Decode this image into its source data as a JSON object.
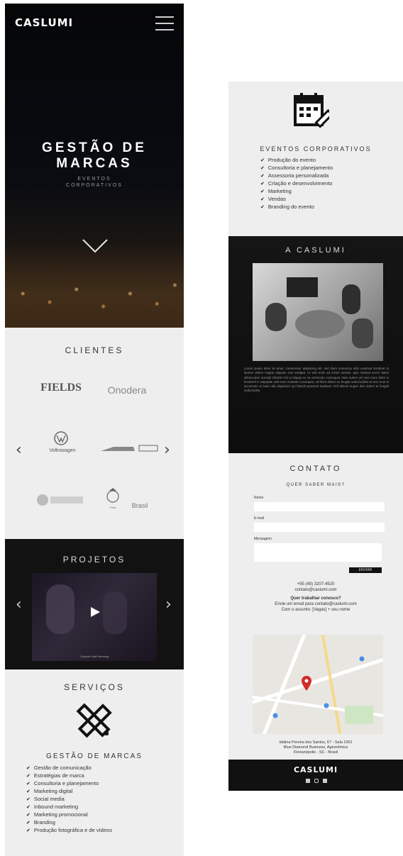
{
  "brand": {
    "logo": "CASLUMI"
  },
  "hero": {
    "title_line1": "GESTÃO DE",
    "title_line2": "MARCAS",
    "subtitle_line1": "EVENTOS",
    "subtitle_line2": "CORPORATIVOS"
  },
  "clientes": {
    "title": "CLIENTES",
    "logos": [
      "FIELDS",
      "Onodera",
      "Volkswagen",
      "",
      "",
      "",
      "Real",
      "Brasil"
    ]
  },
  "projetos": {
    "title": "PROJETOS",
    "caption": "Caslumi Kraft Wenning"
  },
  "servicos": {
    "title": "SERVIÇOS",
    "gestao": {
      "heading": "GESTÃO DE MARCAS",
      "items": [
        "Gestão de comunicação",
        "Estratégias de marca",
        "Consultoria e planejamento",
        "Marketing digital",
        "Social media",
        "Inbound marketing",
        "Marketing promocional",
        "Branding",
        "Produção fotográfica e de vídeos"
      ]
    },
    "eventos": {
      "heading": "EVENTOS CORPORATIVOS",
      "items": [
        "Produção do evento",
        "Consultoria e planejamento",
        "Assessoria personalizada",
        "Criação e desenvolvimento",
        "Marketing",
        "Vendas",
        "Branding do evento"
      ]
    }
  },
  "sobre": {
    "title": "A CASLUMI",
    "paragraph": "Lorem ipsum dolor sit amet, consectetur adipiscing elit, sed diam nonummy nibh euismod tincidunt ut laoreet dolore magna aliquam erat volutpat. Ut wisi enim ad minim veniam, quis nostrud exerci tation ullamcorper suscipit lobortis nisl ut aliquip ex ea commodo consequat. Duis autem vel eum iriure dolor in hendrerit in vulputate velit esse molestie consequat, vel illum dolore eu feugiat nulla facilisis at vero eros et accumsan et iusto odio dignissim qui blandit praesent luptatum zzril delenit augue duis dolore te feugait nulla facilisi."
  },
  "contato": {
    "title": "CONTATO",
    "subtitle": "QUER SABER MAIS?",
    "name_label": "Nome",
    "email_label": "E-mail",
    "message_label": "Mensagem",
    "send_label": "ENVIAR",
    "phone": "+55 (48) 3207-4520",
    "email": "contato@caslumi.com",
    "work_heading": "Quer trabalhar conosco?",
    "work_line1": "Envie um email para contato@caslumi.com",
    "work_line2": "Com o assunto: [Vagas] + seu nome",
    "address_line1": "Idalina Pereira dos Santos, 67 - Sala 1001",
    "address_line2": "Blue Diamond Business, Agronômica",
    "address_line3": "Florianópolis - SC - Brasil"
  },
  "colors": {
    "dark": "#111111",
    "light": "#eeeeee",
    "accent_pin": "#d22b2b"
  }
}
